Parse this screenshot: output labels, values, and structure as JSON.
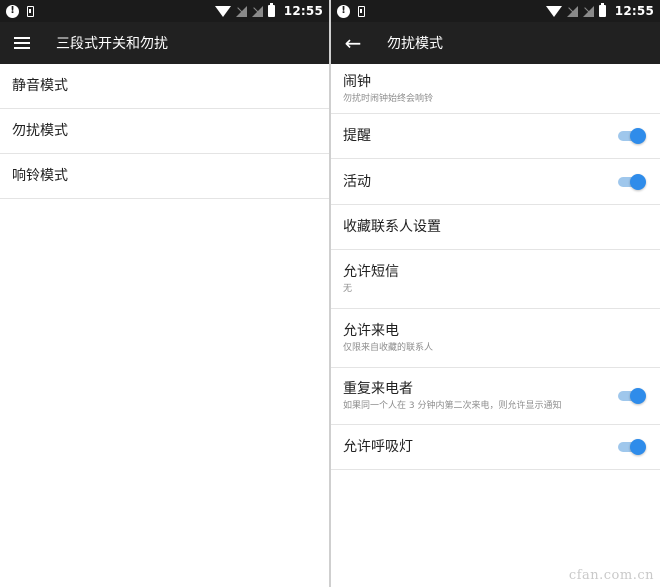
{
  "status_bar": {
    "time": "12:55",
    "alert_glyph": "!"
  },
  "left_screen": {
    "title": "三段式开关和勿扰",
    "nav_icon": "hamburger-menu-icon",
    "items": [
      {
        "label": "静音模式"
      },
      {
        "label": "勿扰模式"
      },
      {
        "label": "响铃模式"
      }
    ]
  },
  "right_screen": {
    "title": "勿扰模式",
    "nav_icon": "back-arrow-icon",
    "back_glyph": "←",
    "items": [
      {
        "title": "闹钟",
        "subtitle": "勿扰时闹钟始终会响铃",
        "toggle": null
      },
      {
        "title": "提醒",
        "subtitle": "",
        "toggle": true
      },
      {
        "title": "活动",
        "subtitle": "",
        "toggle": true
      },
      {
        "title": "收藏联系人设置",
        "subtitle": "",
        "toggle": null
      },
      {
        "title": "允许短信",
        "subtitle": "无",
        "toggle": null
      },
      {
        "title": "允许来电",
        "subtitle": "仅限来自收藏的联系人",
        "toggle": null
      },
      {
        "title": "重复来电者",
        "subtitle": "如果同一个人在 3 分钟内第二次来电，则允许显示通知",
        "toggle": true
      },
      {
        "title": "允许呼吸灯",
        "subtitle": "",
        "toggle": true
      }
    ]
  },
  "colors": {
    "toolbar": "#212121",
    "statusbar": "#1b1b1b",
    "accent": "#2f8cea",
    "accent_track": "#9fc7ec"
  },
  "watermark": "cfan.com.cn"
}
